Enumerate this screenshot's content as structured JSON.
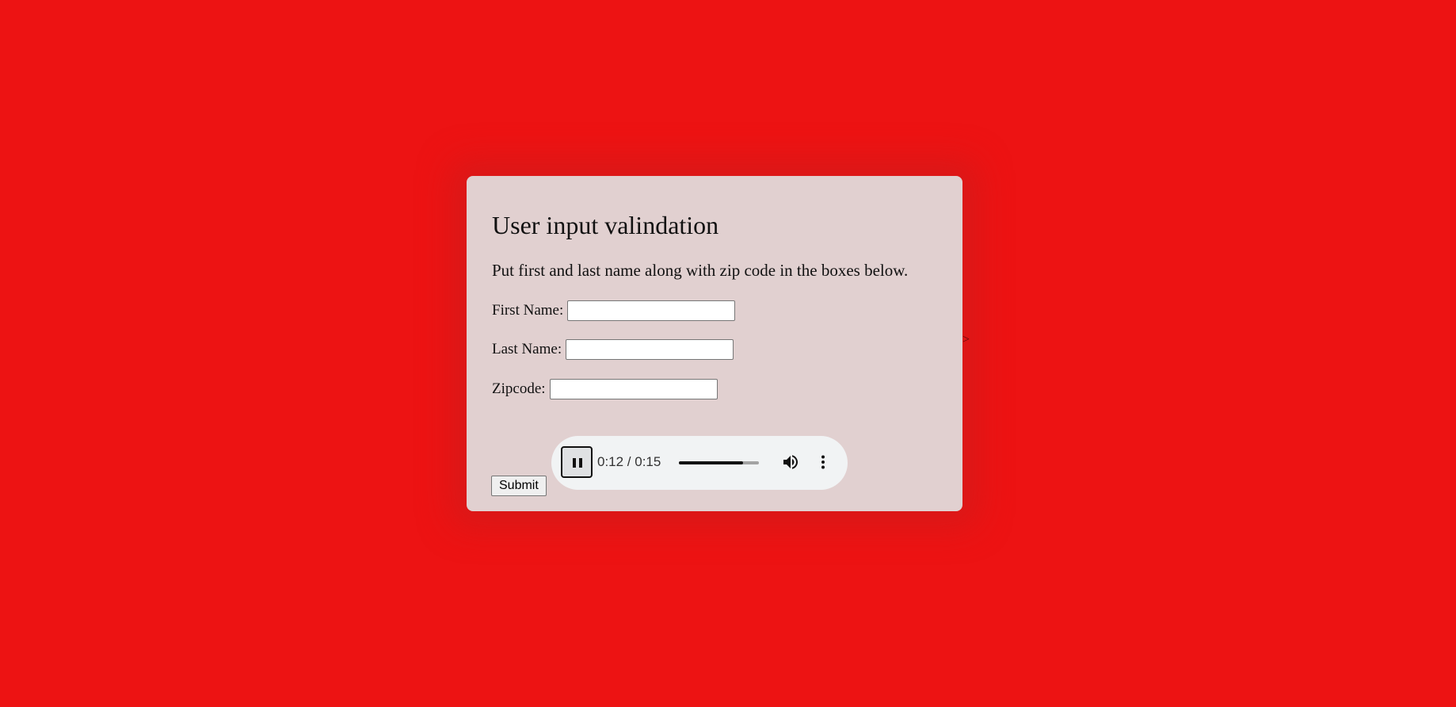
{
  "page": {
    "background_color": "#ed1313",
    "stray_text": ">"
  },
  "card": {
    "background_color": "#e1d0d0",
    "title": "User input valindation",
    "intro": "Put first and last name along with zip code in the boxes below."
  },
  "form": {
    "first_name": {
      "label": "First Name:",
      "value": ""
    },
    "last_name": {
      "label": "Last Name:",
      "value": ""
    },
    "zipcode": {
      "label": "Zipcode:",
      "value": ""
    },
    "submit_label": "Submit"
  },
  "audio_player": {
    "state": "playing",
    "play_button_icon": "pause-icon",
    "time_display": "0:12 / 0:15",
    "progress_fraction": 0.8,
    "volume_icon": "volume-icon",
    "menu_icon": "more-vert-icon"
  }
}
